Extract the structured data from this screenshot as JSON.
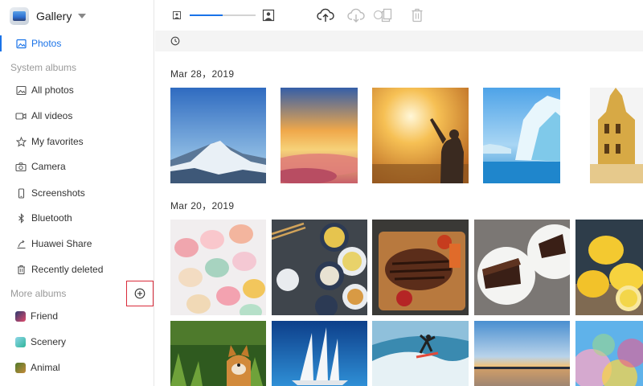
{
  "app": {
    "title": "Gallery"
  },
  "sidebar": {
    "photos_label": "Photos",
    "system_albums_label": "System albums",
    "system_items": [
      "All photos",
      "All videos",
      "My favorites",
      "Camera",
      "Screenshots",
      "Bluetooth",
      "Huawei Share",
      "Recently deleted"
    ],
    "more_albums_label": "More albums",
    "more_items": [
      "Friend",
      "Scenery",
      "Animal"
    ]
  },
  "toolbar": {
    "icons": [
      "small-thumbnail-icon",
      "size-slider",
      "large-thumbnail-icon",
      "upload-icon",
      "download-icon",
      "copy-icon",
      "delete-icon"
    ],
    "thumbnail_size": 0.5
  },
  "timeline": {
    "groups": [
      {
        "date": "Mar 28，2019",
        "photos": [
          "mountain-snow",
          "sunset-clouds",
          "person-sunrise",
          "iceberg-sea",
          "tower-building"
        ]
      },
      {
        "date": "Mar 20，2019",
        "photos": [
          "macarons",
          "dumplings",
          "steak",
          "cake-slice",
          "lemons",
          "corgi",
          "sailing-ship",
          "surfer",
          "lake-dusk",
          "colorful-powder"
        ]
      }
    ]
  },
  "colors": {
    "accent": "#1a73e8",
    "highlight_border": "#d92b3a"
  }
}
